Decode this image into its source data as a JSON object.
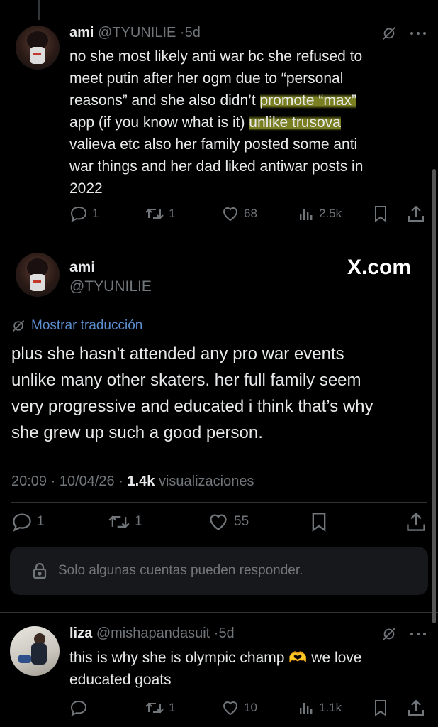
{
  "colors": {
    "background": "#000000",
    "text": "#e7e9ea",
    "muted": "#71767b",
    "link": "#1d9bf0",
    "highlight": "#dee83c"
  },
  "reply1": {
    "name": "ami",
    "handle": "@TYUNILIE",
    "time": "5d",
    "text_a": "no she most likely anti war bc she refused to",
    "text_b": "meet putin after her ogm due to “personal",
    "text_c1": "reasons” and she also didn’t ",
    "text_c2": "promote “max”",
    "text_d1": "app (if you know what is it) ",
    "text_d2": "unlike trusova",
    "text_e": "valieva etc also her family posted some anti",
    "text_f": "war things and her dad liked antiwar posts in",
    "text_g": "2022",
    "replies": "1",
    "reposts": "1",
    "likes": "68",
    "views": "2.5k"
  },
  "main": {
    "name": "ami",
    "handle": "@TYUNILIE",
    "site_label": "X.com",
    "translate": "Mostrar traducción",
    "line1": "plus she hasn’t attended any pro war events",
    "line2": "unlike many other skaters. her full family seem",
    "line3": "very progressive and educated i think that’s why",
    "line4": "she grew up such a good person.",
    "meta_time": "20:09 · 10/04/26 · ",
    "meta_views": "1.4k",
    "meta_views_label": " visualizaciones",
    "replies": "1",
    "reposts": "1",
    "likes": "55",
    "restricted": "Solo algunas cuentas pueden responder."
  },
  "reply2": {
    "name": "liza",
    "handle": "@mishapandasuit",
    "time": "5d",
    "text_a1": "this is why she is olympic champ ",
    "emoji": "🫶",
    "text_a2": " we love",
    "text_b": "educated goats",
    "reposts": "1",
    "likes": "10",
    "views": "1.1k"
  },
  "icons": [
    "grok-icon",
    "more-icon",
    "reply-icon",
    "repost-icon",
    "like-icon",
    "views-icon",
    "bookmark-icon",
    "share-icon",
    "lock-icon",
    "translate-icon"
  ]
}
